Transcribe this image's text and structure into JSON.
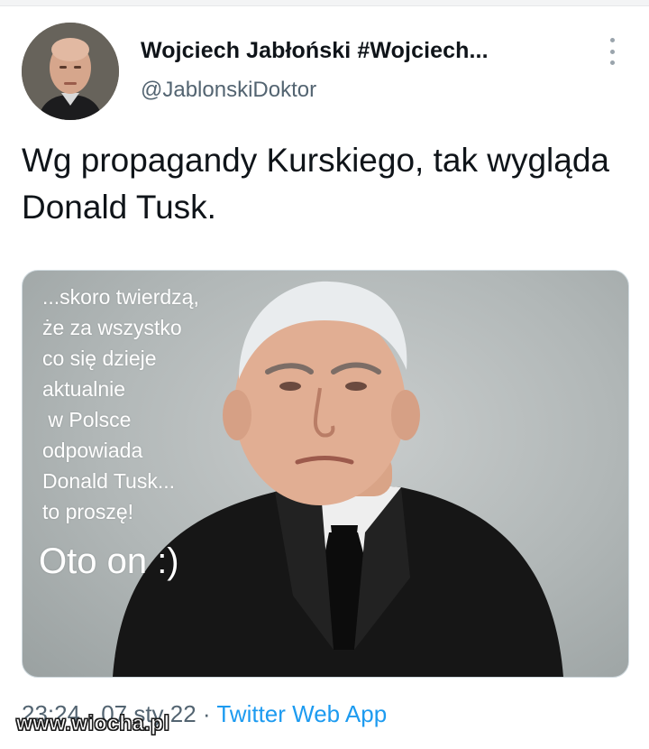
{
  "author": {
    "name": "Wojciech Jabłoński #Wojciech...",
    "handle": "@JablonskiDoktor",
    "avatar_icon": "profile-photo"
  },
  "tweet": {
    "text": "Wg propagandy Kurskiego, tak wygląda Donald Tusk."
  },
  "media": {
    "overlay_text": "...skoro twierdzą,\nże za wszystko\nco się dzieje\naktualnie\n w Polsce\nodpowiada\nDonald Tusk...\nto proszę!",
    "overlay_big": "Oto on :)"
  },
  "meta": {
    "time": "23:24",
    "separator": " · ",
    "date": "07 sty 22",
    "separator2": " · ",
    "source": "Twitter Web App"
  },
  "watermark": "www.wiocha.pl",
  "more_icon": "more-vertical-icon",
  "colors": {
    "text": "#0f1419",
    "secondary": "#536471",
    "accent": "#1d9bf0"
  }
}
